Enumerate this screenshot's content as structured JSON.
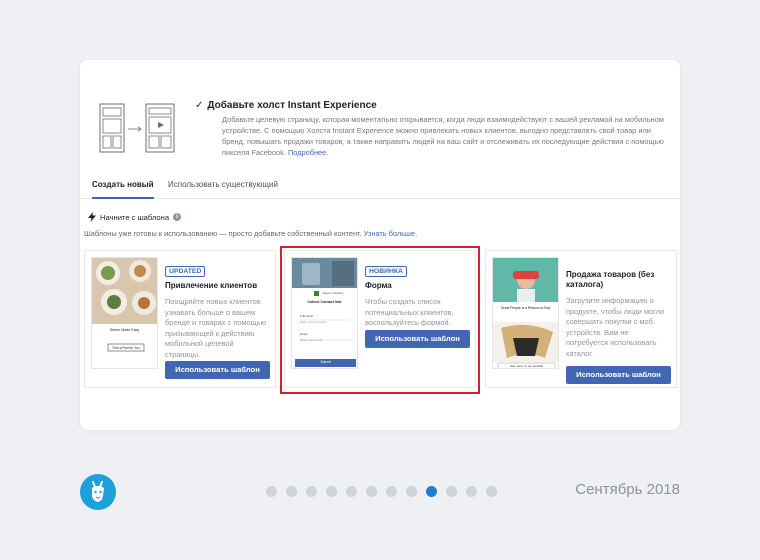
{
  "header": {
    "title": "Добавьте холст Instant Experience",
    "description": "Добавьте целевую страницу, которая моментально открывается, когда люди взаимодействуют с вашей рекламой на мобильном устройстве. С помощью Холста Instant Experience можно привлекать новых клиентов, выгодно представлять свой товар или бренд, повышать продажи товаров, а также направить людей на ваш сайт и отслеживать их последующие действия с помощью пикселя Facebook.",
    "more_link": "Подробнее."
  },
  "tabs": {
    "create": "Создать новый",
    "existing": "Использовать существующий"
  },
  "start": {
    "title": "Начните с шаблона",
    "subtitle": "Шаблоны уже готовы к использованию — просто добавьте собственный контент.",
    "learn_more": "Узнать больше."
  },
  "templates": [
    {
      "badge": "UPDATED",
      "title": "Привлечение клиентов",
      "description": "Поощряйте новых клиентов узнавать больше о вашем бренде и товарах с помощью призывающей к действию мобильной целевой страницы.",
      "button": "Использовать шаблон",
      "preview_caption": "Dinner Made Easy",
      "preview_button": "Find a Plan for You"
    },
    {
      "badge": "НОВИНКА",
      "title": "Форма",
      "description": "Чтобы создать список потенциальных клиентов, воспользуйтесь формой.",
      "button": "Использовать шаблон",
      "preview_brand": "Jasper's Market",
      "preview_heading": "Collect Contact Info",
      "preview_field_1": "Full name",
      "preview_placeholder_1": "Enter your full name",
      "preview_field_2": "Email",
      "preview_placeholder_2": "Enter your email",
      "preview_submit": "Submit"
    },
    {
      "badge": "",
      "title": "Продажа товаров (без каталога)",
      "description": "Загрузите информацию о продукте, чтобы люди могли совершать покупки с моб. устройств. Вам не потребуется использовать каталог.",
      "button": "Использовать шаблон",
      "preview_heading": "Great People is a Reason to Buy",
      "preview_button": "See more on our website"
    }
  ],
  "footer": {
    "date": "Сентябрь 2018",
    "active_dot": 8,
    "dot_count": 12
  },
  "colors": {
    "accent": "#4267b2",
    "highlight_frame": "#d32131",
    "logo": "#1ea0d8",
    "active_dot": "#1b7fd1"
  }
}
